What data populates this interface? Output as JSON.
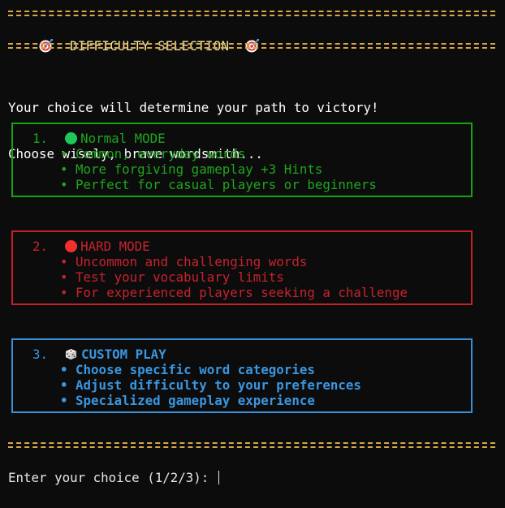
{
  "header": {
    "title": "DIFFICULTY SELECTION",
    "icon": "target-icon",
    "rule_color": "#d6a64a"
  },
  "intro": {
    "line1": "Your choice will determine your path to victory!",
    "line2": "Choose wisely, brave wordsmith..."
  },
  "options": [
    {
      "number": "1.",
      "icon": "green-circle-icon",
      "label": "Normal MODE",
      "color": "#1fa51f",
      "bullets": [
        "• Common, everyday words",
        "• More forgiving gameplay +3 Hints",
        "• Perfect for casual players or beginners"
      ]
    },
    {
      "number": "2.",
      "icon": "red-circle-icon",
      "label": "HARD MODE",
      "color": "#c7232e",
      "bullets": [
        "• Uncommon and challenging words",
        "• Test your vocabulary limits",
        "• For experienced players seeking a challenge"
      ]
    },
    {
      "number": "3.",
      "icon": "die-icon",
      "label": "CUSTOM PLAY",
      "color": "#3b96e0",
      "bullets": [
        "• Choose specific word categories",
        "• Adjust difficulty to your preferences",
        "• Specialized gameplay experience"
      ]
    }
  ],
  "prompt": {
    "text": "Enter your choice (1/2/3): "
  }
}
